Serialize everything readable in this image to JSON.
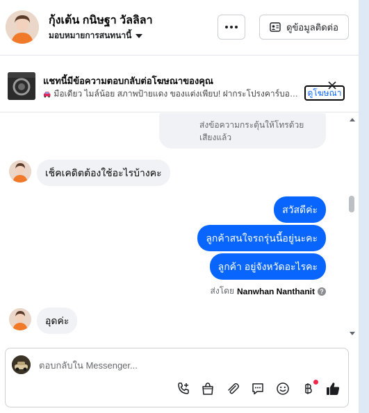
{
  "header": {
    "contact_name": "กุ้งเต้น กนิษฐา วัลลิลา",
    "assign_label": "มอบหมายการสนทนานี้",
    "contact_info_label": "ดูข้อมูลติดต่อ"
  },
  "ad_banner": {
    "title": "แชทนี้มีข้อความตอบกลับต่อโฆษณาของคุณ",
    "subtitle": "มือเดียว ไมล์น้อย สภาพป้ายแดง ของแต่งเพียบ! ฝากระโปรงคาร์บอน พร้...",
    "view_ad_label": "ดูโฆษณา"
  },
  "chat": {
    "system_message": "ส่งข้อความกระตุ้นให้โทรด้วยเสียงแล้ว",
    "messages": [
      {
        "direction": "in",
        "text": "เช็คเคดิตต้องใช้อะไรบ้างคะ"
      },
      {
        "direction": "out",
        "text": "สวัสดีค่ะ"
      },
      {
        "direction": "out",
        "text": "ลูกค้าสนใจรถรุ่นนี้อยู่นะคะ"
      },
      {
        "direction": "out",
        "text": "ลูกค้า อยู่จังหวัดอะไรคะ"
      },
      {
        "direction": "in",
        "text": "อุดค่ะ"
      }
    ],
    "sent_by_prefix": "ส่งโดย",
    "sent_by_name": "Nanwhan Nanthanit"
  },
  "composer": {
    "placeholder": "ตอบกลับใน Messenger..."
  },
  "colors": {
    "accent": "#0866ff",
    "incoming_bubble": "#f0f2f5",
    "notification_dot": "#f02849"
  }
}
